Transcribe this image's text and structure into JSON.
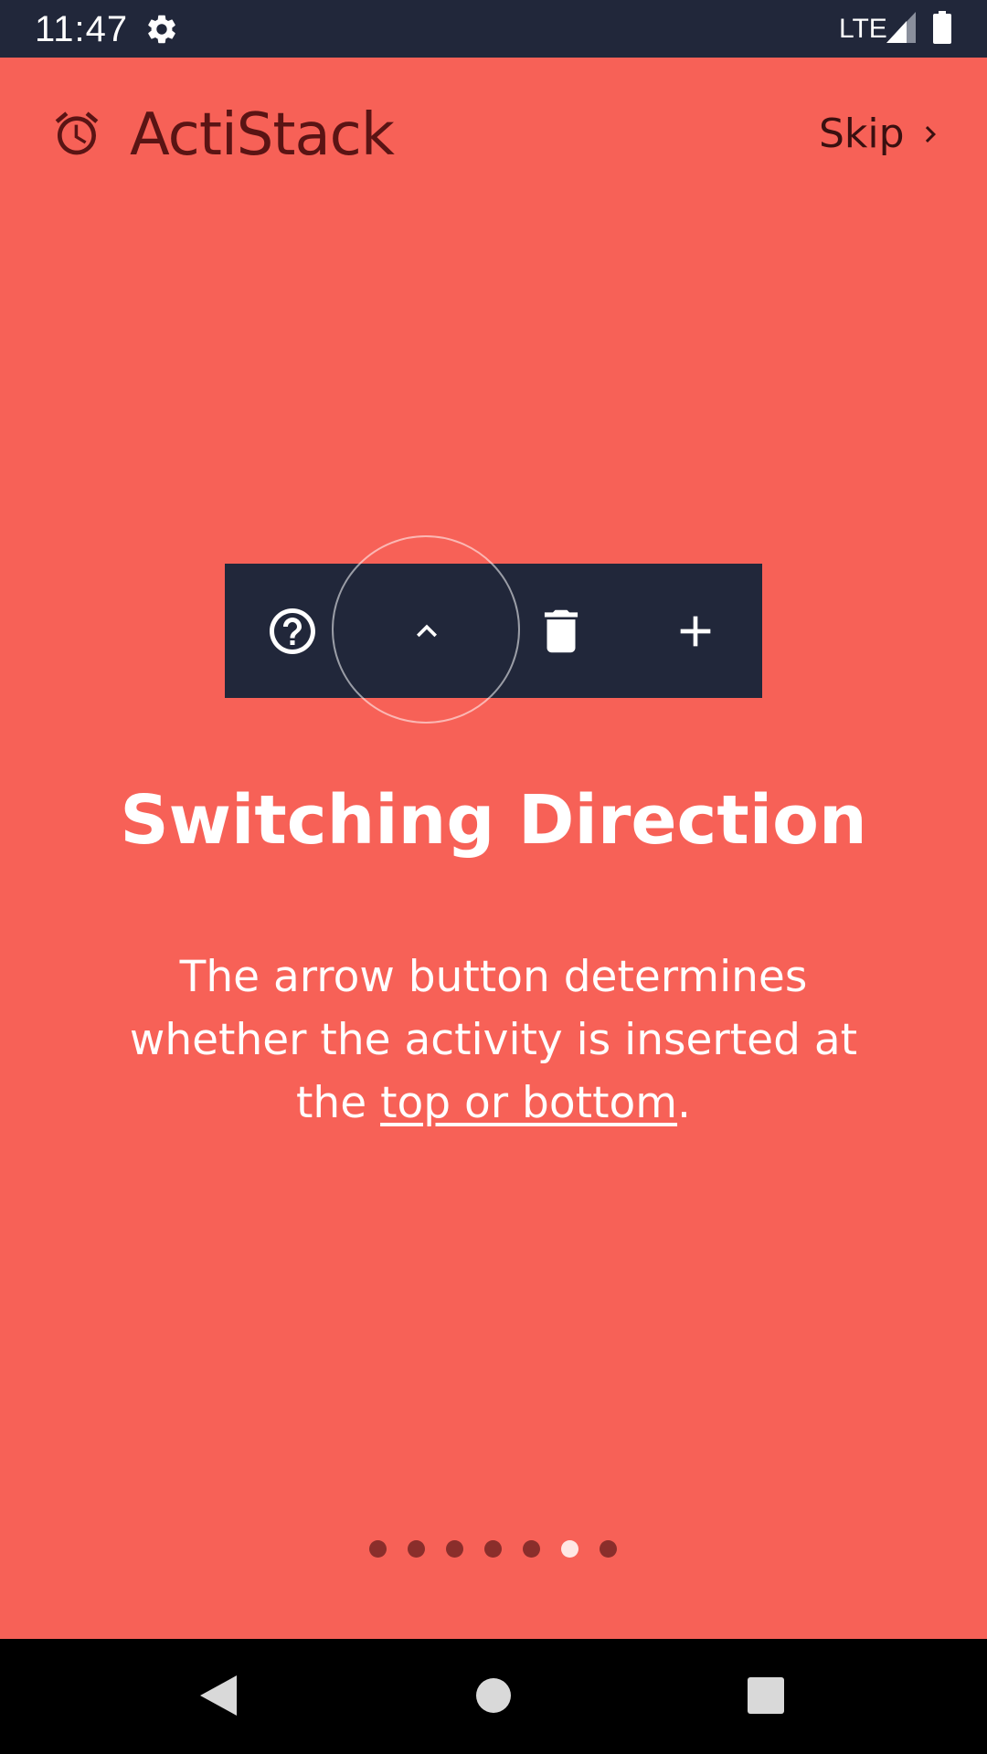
{
  "status_bar": {
    "time": "11:47",
    "network": "LTE",
    "icons": [
      "gear-icon",
      "signal-icon",
      "battery-icon"
    ]
  },
  "header": {
    "app_name": "ActiStack",
    "logo_icon": "alarm-clock-icon",
    "skip_label": "Skip",
    "skip_icon": "chevron-right-icon"
  },
  "toolbar": {
    "buttons": [
      "help-icon",
      "chevron-up-icon",
      "trash-icon",
      "plus-icon"
    ],
    "highlighted": "chevron-up-icon"
  },
  "slide": {
    "title": "Switching Direction",
    "body_text": "The arrow button determines whether the activity is inserted at the ",
    "body_link": "top or bottom",
    "body_end": "."
  },
  "pager": {
    "total": 7,
    "current_index": 5
  },
  "nav_bar": {
    "icons": [
      "back-icon",
      "home-icon",
      "recents-icon"
    ]
  },
  "colors": {
    "background": "#F76157",
    "toolbar": "#21273A",
    "title_text": "#5A1414",
    "dot": "#8A2E2B",
    "dot_active": "#FFE7E4"
  }
}
